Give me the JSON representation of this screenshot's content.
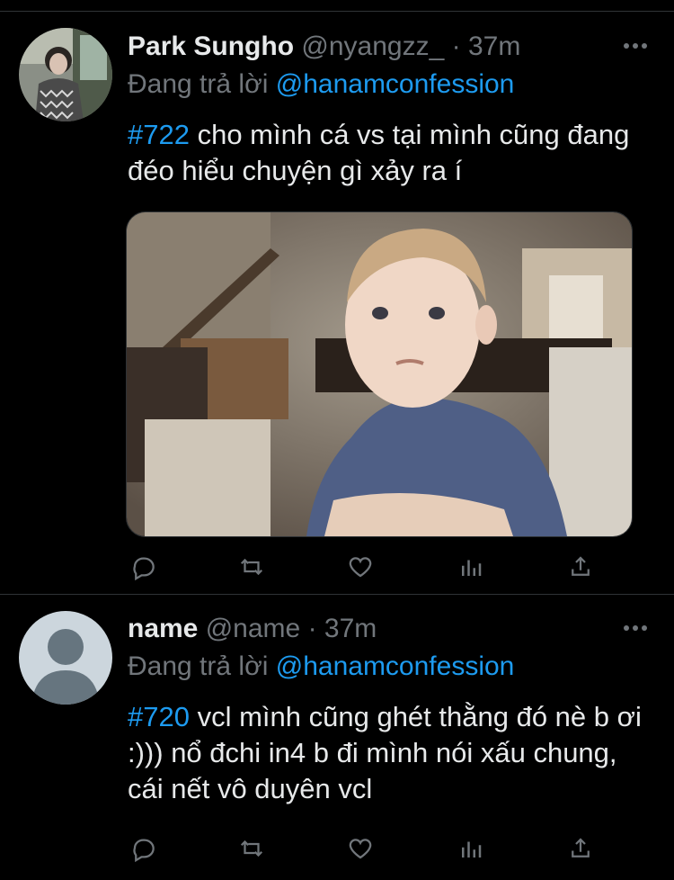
{
  "tweets": [
    {
      "author_name": "Park Sungho",
      "handle": "@nyangzz_",
      "separator": "·",
      "time": "37m",
      "replying_prefix": "Đang trả lời ",
      "replying_to": "@hanamconfession",
      "hashtag": "#722",
      "text": " cho mình cá vs tại mình cũng đang đéo hiểu chuyện gì xảy ra í",
      "has_image": true
    },
    {
      "author_name": "name",
      "handle": "@name",
      "separator": "·",
      "time": "37m",
      "replying_prefix": "Đang trả lời ",
      "replying_to": "@hanamconfession",
      "hashtag": "#720",
      "text": " vcl mình cũng ghét thằng đó nè b ơi :))) nổ đchi in4 b đi mình nói xấu chung, cái nết vô duyên vcl",
      "has_image": false
    }
  ],
  "icons": {
    "more": "more-horizontal-icon",
    "reply": "reply-icon",
    "retweet": "retweet-icon",
    "like": "heart-icon",
    "views": "analytics-icon",
    "share": "share-icon"
  },
  "colors": {
    "background": "#000000",
    "text": "#e7e9ea",
    "secondary": "#71767b",
    "accent": "#1d9bf0",
    "divider": "#2f3336"
  }
}
